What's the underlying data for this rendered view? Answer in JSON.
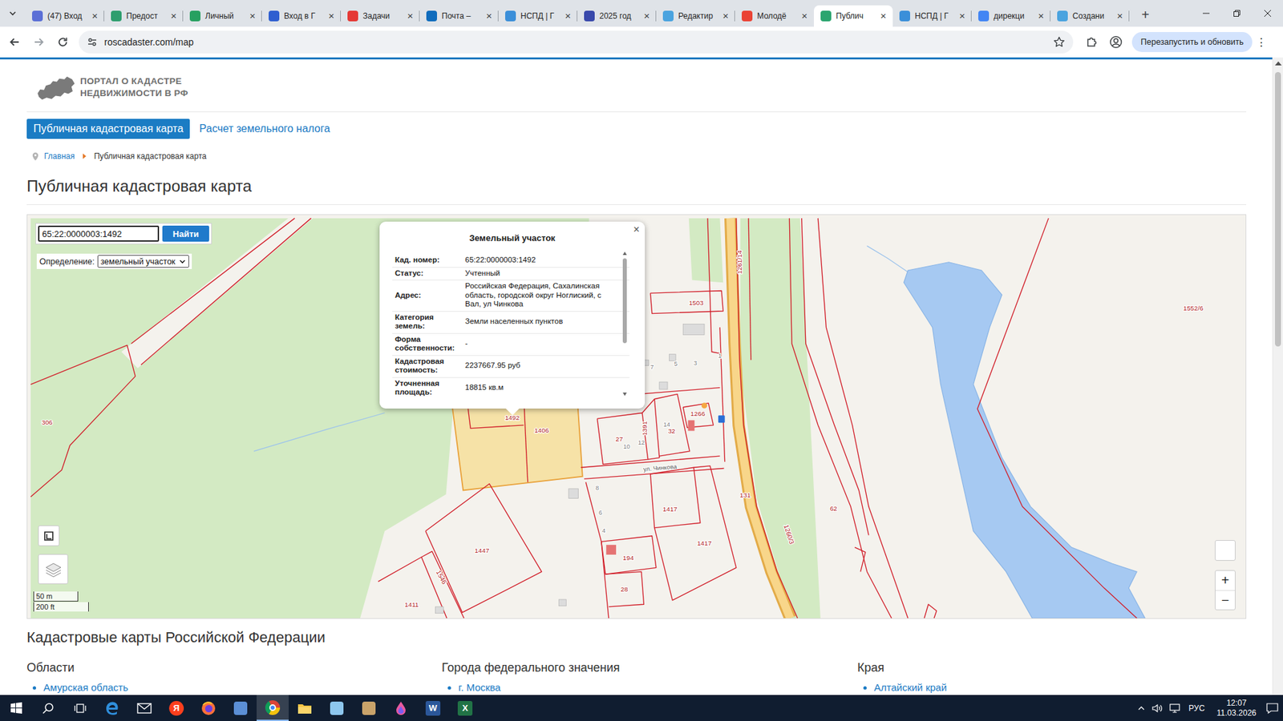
{
  "browser": {
    "tabs": [
      {
        "label": "(47) Вход",
        "selected": false,
        "color": "#5b6fd6"
      },
      {
        "label": "Предост",
        "selected": false,
        "color": "#2e9e6e"
      },
      {
        "label": "Личный",
        "selected": false,
        "color": "#27a060"
      },
      {
        "label": "Вход в Г",
        "selected": false,
        "color": "#2f5fd0"
      },
      {
        "label": "Задачи",
        "selected": false,
        "color": "#e53935"
      },
      {
        "label": "Почта –",
        "selected": false,
        "color": "#0f6cbd"
      },
      {
        "label": "НСПД | Г",
        "selected": false,
        "color": "#3b8fd9"
      },
      {
        "label": "2025 год",
        "selected": false,
        "color": "#3949ab"
      },
      {
        "label": "Редактир",
        "selected": false,
        "color": "#4aa3df"
      },
      {
        "label": "Молодё",
        "selected": false,
        "color": "#ea4335"
      },
      {
        "label": "Публич",
        "selected": true,
        "color": "#2ba56f"
      },
      {
        "label": "НСПД | Г",
        "selected": false,
        "color": "#3b8fd9"
      },
      {
        "label": "дирекци",
        "selected": false,
        "color": "#4285f4"
      },
      {
        "label": "Создани",
        "selected": false,
        "color": "#4aa3df"
      }
    ],
    "tab_close": "×",
    "new_tab": "+",
    "address": "roscadaster.com/map",
    "restart_button": "Перезапустить и обновить",
    "menu": "⋮"
  },
  "site": {
    "logo_line1": "ПОРТАЛ О КАДАСТРЕ",
    "logo_line2": "НЕДВИЖИМОСТИ В РФ"
  },
  "nav": [
    {
      "label": "Публичная кадастровая карта",
      "selected": true
    },
    {
      "label": "Расчет земельного налога",
      "selected": false
    }
  ],
  "breadcrumb": [
    "Главная",
    "Публичная кадастровая карта"
  ],
  "heading": "Публичная кадастровая карта",
  "map": {
    "search_value": "65:22:0000003:1492",
    "search_button": "Найти",
    "mode_label": "Определение:",
    "mode_value": "земельный участок",
    "popup": {
      "title": "Земельный участок",
      "close": "×",
      "rows": [
        {
          "label": "Кад. номер:",
          "value": "65:22:0000003:1492"
        },
        {
          "label": "Статус:",
          "value": "Учтенный"
        },
        {
          "label": "Адрес:",
          "value": "Российская Федерация, Сахалинская область, городской округ Ноглиский, с Вал, ул Чинкова"
        },
        {
          "label": "Категория земель:",
          "value": "Земли населенных пунктов"
        },
        {
          "label": "Форма собственности:",
          "value": "-"
        },
        {
          "label": "Кадастровая стоимость:",
          "value": "2237667.95 руб"
        },
        {
          "label": "Уточненная площадь:",
          "value": "18815 кв.м"
        }
      ],
      "scroll_level": 0.65
    },
    "parcel_labels": [
      "1552/6",
      "306",
      "1503",
      "1261/14",
      "1492",
      "1406",
      "27",
      "1391",
      "32",
      "1266",
      "1417",
      "1417",
      "131",
      "62",
      "1260/3",
      "1447",
      "1546",
      "194",
      "28",
      "1411"
    ],
    "house_numbers": [
      "7",
      "5",
      "3",
      "1",
      "10",
      "12",
      "14",
      "8",
      "6",
      "4"
    ],
    "street_label": "ул. Чинкова",
    "scale": [
      "50 m",
      "200 ft"
    ],
    "zoom": [
      "+",
      "−"
    ]
  },
  "catalog": {
    "title": "Кадастровые карты Российской Федерации",
    "columns": [
      {
        "heading": "Области",
        "items": [
          "Амурская область"
        ]
      },
      {
        "heading": "Города федерального значения",
        "items": [
          "г. Москва"
        ]
      },
      {
        "heading": "Края",
        "items": [
          "Алтайский край"
        ]
      }
    ]
  },
  "scrollbar": {
    "level": 0.43
  },
  "taskbar": {
    "apps": [
      {
        "kind": "start",
        "selected": false
      },
      {
        "kind": "search",
        "selected": false
      },
      {
        "kind": "taskview",
        "selected": false
      },
      {
        "kind": "edge",
        "selected": false
      },
      {
        "kind": "mail",
        "selected": false
      },
      {
        "kind": "yandex",
        "selected": false,
        "label": "Я"
      },
      {
        "kind": "firefox",
        "selected": false
      },
      {
        "kind": "app",
        "selected": false,
        "color": "#5b8fd6"
      },
      {
        "kind": "chrome",
        "selected": true
      },
      {
        "kind": "explorer",
        "selected": false
      },
      {
        "kind": "app",
        "selected": false,
        "color": "#8ec7ee"
      },
      {
        "kind": "app",
        "selected": false,
        "color": "#c9a36a"
      },
      {
        "kind": "drop",
        "selected": false
      },
      {
        "kind": "word",
        "selected": false,
        "label": "W"
      },
      {
        "kind": "excel",
        "selected": false,
        "label": "X"
      }
    ],
    "language": "РУС",
    "time": "12:07",
    "date": "11.03.2026"
  }
}
